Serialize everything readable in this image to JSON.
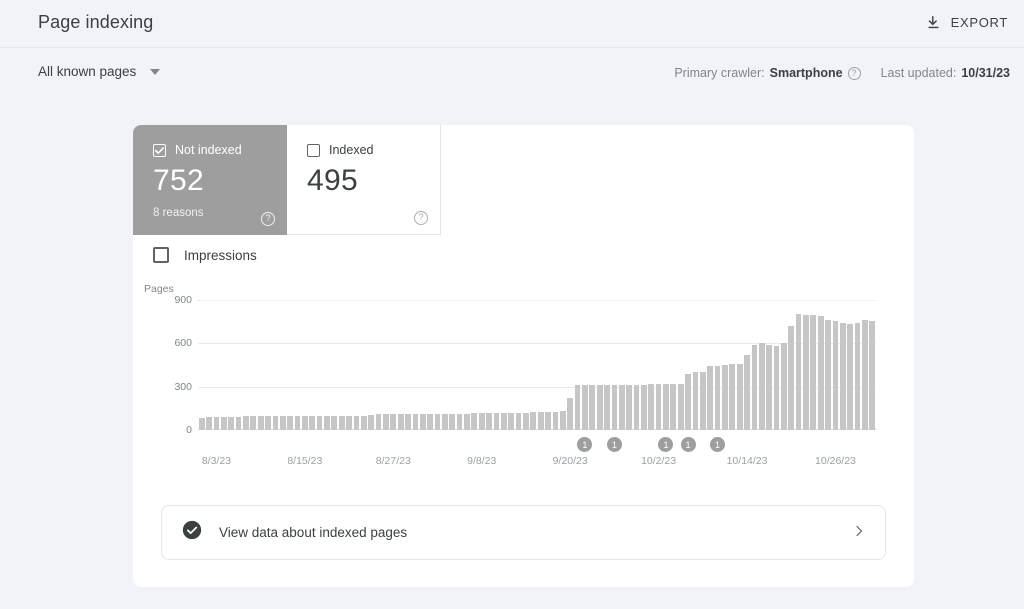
{
  "header": {
    "title": "Page indexing",
    "export_label": "EXPORT",
    "export_icon": "download-icon"
  },
  "subheader": {
    "filter_label": "All known pages",
    "filter_caret_icon": "chevron-down-icon",
    "crawler_prefix": "Primary crawler:",
    "crawler_value": "Smartphone",
    "crawler_help_icon": "help-icon",
    "help_glyph": "?",
    "updated_prefix": "Last updated:",
    "updated_value": "10/31/23"
  },
  "cards": [
    {
      "label": "Not indexed",
      "value": "752",
      "sub": "8 reasons",
      "checked": true,
      "selected": true,
      "help_glyph": "?",
      "checkbox_icon": "checkbox-checked-icon",
      "help_icon": "help-icon"
    },
    {
      "label": "Indexed",
      "value": "495",
      "sub": "",
      "checked": false,
      "selected": false,
      "help_glyph": "?",
      "checkbox_icon": "checkbox-unchecked-icon",
      "help_icon": "help-icon"
    }
  ],
  "impressions": {
    "label": "Impressions",
    "checked": false,
    "checkbox_icon": "checkbox-unchecked-icon"
  },
  "footer_link": {
    "label": "View data about indexed pages",
    "leading_icon": "check-circle-icon",
    "trailing_icon": "chevron-right-icon"
  },
  "colors": {
    "page_background": "#f1f3f9",
    "panel": "#ffffff",
    "bar": "#c6c6c6",
    "selected_card": "#9e9e9e",
    "text_primary": "#3c4043",
    "text_secondary": "#80868b",
    "gridline": "#e8eaed"
  },
  "chart_data": {
    "type": "bar",
    "title": "",
    "xlabel": "",
    "ylabel": "Pages",
    "ylim": [
      0,
      900
    ],
    "yticks": [
      0,
      300,
      600,
      900
    ],
    "ytick_labels": [
      "0",
      "300",
      "600",
      "900"
    ],
    "grid": true,
    "legend": "none",
    "series_name": "Not indexed",
    "xtick_labels": [
      "8/3/23",
      "8/15/23",
      "8/27/23",
      "9/8/23",
      "9/20/23",
      "10/2/23",
      "10/14/23",
      "10/26/23"
    ],
    "xtick_indices": [
      2,
      14,
      26,
      38,
      50,
      62,
      74,
      86
    ],
    "x": [
      "8/1/23",
      "8/2/23",
      "8/3/23",
      "8/4/23",
      "8/5/23",
      "8/6/23",
      "8/7/23",
      "8/8/23",
      "8/9/23",
      "8/10/23",
      "8/11/23",
      "8/12/23",
      "8/13/23",
      "8/14/23",
      "8/15/23",
      "8/16/23",
      "8/17/23",
      "8/18/23",
      "8/19/23",
      "8/20/23",
      "8/21/23",
      "8/22/23",
      "8/23/23",
      "8/24/23",
      "8/25/23",
      "8/26/23",
      "8/27/23",
      "8/28/23",
      "8/29/23",
      "8/30/23",
      "8/31/23",
      "9/1/23",
      "9/2/23",
      "9/3/23",
      "9/4/23",
      "9/5/23",
      "9/6/23",
      "9/7/23",
      "9/8/23",
      "9/9/23",
      "9/10/23",
      "9/11/23",
      "9/12/23",
      "9/13/23",
      "9/14/23",
      "9/15/23",
      "9/16/23",
      "9/17/23",
      "9/18/23",
      "9/19/23",
      "9/20/23",
      "9/21/23",
      "9/22/23",
      "9/23/23",
      "9/24/23",
      "9/25/23",
      "9/26/23",
      "9/27/23",
      "9/28/23",
      "9/29/23",
      "9/30/23",
      "10/1/23",
      "10/2/23",
      "10/3/23",
      "10/4/23",
      "10/5/23",
      "10/6/23",
      "10/7/23",
      "10/8/23",
      "10/9/23",
      "10/10/23",
      "10/11/23",
      "10/12/23",
      "10/13/23",
      "10/14/23",
      "10/15/23",
      "10/16/23",
      "10/17/23",
      "10/18/23",
      "10/19/23",
      "10/20/23",
      "10/21/23",
      "10/22/23",
      "10/23/23",
      "10/24/23",
      "10/25/23",
      "10/26/23",
      "10/27/23",
      "10/28/23",
      "10/29/23",
      "10/30/23",
      "10/31/23"
    ],
    "values": [
      85,
      88,
      88,
      90,
      88,
      90,
      95,
      95,
      95,
      95,
      95,
      98,
      98,
      98,
      100,
      100,
      100,
      100,
      100,
      100,
      100,
      100,
      100,
      105,
      108,
      108,
      108,
      110,
      110,
      110,
      110,
      112,
      112,
      112,
      112,
      112,
      112,
      115,
      115,
      115,
      118,
      118,
      120,
      120,
      120,
      122,
      125,
      125,
      125,
      130,
      225,
      310,
      310,
      310,
      312,
      312,
      312,
      312,
      315,
      315,
      315,
      318,
      320,
      320,
      320,
      320,
      390,
      400,
      400,
      440,
      445,
      450,
      455,
      460,
      520,
      590,
      600,
      590,
      585,
      600,
      720,
      800,
      795,
      795,
      790,
      760,
      755,
      740,
      735,
      740,
      760,
      755
    ],
    "annotations": [
      {
        "index": 52,
        "label": "1"
      },
      {
        "index": 56,
        "label": "1"
      },
      {
        "index": 63,
        "label": "1"
      },
      {
        "index": 66,
        "label": "1"
      },
      {
        "index": 70,
        "label": "1"
      }
    ]
  }
}
